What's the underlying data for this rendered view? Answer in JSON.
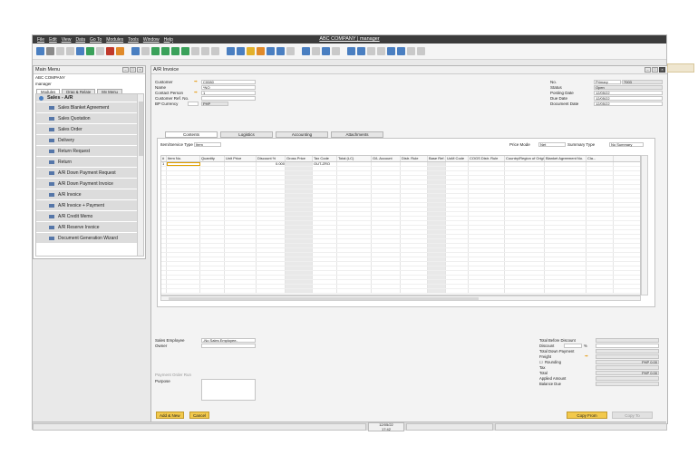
{
  "menu": [
    "File",
    "Edit",
    "View",
    "Data",
    "Go To",
    "Modules",
    "Tools",
    "Window",
    "Help"
  ],
  "app_title": "ABC COMPANY | manager",
  "main_menu": {
    "title": "Main Menu",
    "company": "ABC COMPANY",
    "user": "manager",
    "tabs": [
      "Modules",
      "Drag & Relate",
      "My Menu"
    ],
    "module": "Sales - A/R",
    "items": [
      "Sales Blanket Agreement",
      "Sales Quotation",
      "Sales Order",
      "Delivery",
      "Return Request",
      "Return",
      "A/R Down Payment Request",
      "A/R Down Payment Invoice",
      "A/R Invoice",
      "A/R Invoice + Payment",
      "A/R Credit Memo",
      "A/R Reserve Invoice",
      "Document Generation Wizard"
    ]
  },
  "ar": {
    "title": "A/R Invoice",
    "customer_label": "Customer",
    "customer_value": "C0080",
    "name_label": "Name",
    "name_value": "*NO",
    "contact_label": "Contact Person",
    "contact_value": "1",
    "custref_label": "Customer Ref. No.",
    "bpcur_label": "BP Currency",
    "bpcur_value": "PHP",
    "no_label": "No.",
    "series_value": "Primary",
    "no_value": "7003",
    "status_label": "Status",
    "status_value": "Open",
    "posting_label": "Posting Date",
    "posting_value": "12/05/22",
    "due_label": "Due Date",
    "due_value": "12/05/22",
    "docdate_label": "Document Date",
    "docdate_value": "12/05/22",
    "tabs": [
      "Contents",
      "Logistics",
      "Accounting",
      "Attachments"
    ],
    "item_type_label": "Item/Service Type",
    "item_type_value": "Item",
    "price_mode_label": "Price Mode",
    "price_mode_value": "Net",
    "summary_label": "Summary Type",
    "summary_value": "No Summary",
    "columns": [
      "#",
      "Item No.",
      "Quantity",
      "Unit Price",
      "Discount %",
      "Gross Price",
      "Tax Code",
      "Total (LC)",
      "G/L Account",
      "Distr. Rule",
      "Base Ref.",
      "UoM Code",
      "COGS Distr. Rule",
      "Country/Region of Origin",
      "Blanket Agreement No.",
      "Cla..."
    ],
    "row1": {
      "num": "1",
      "discount": "0.000",
      "tax": "OUT-ZRO"
    },
    "sales_emp_label": "Sales Employee",
    "sales_emp_value": "-No Sales Employee-",
    "owner_label": "Owner",
    "payment_order_label": "Payment Order Run",
    "purpose_label": "Purpose",
    "totals": {
      "before_discount": "Total Before Discount",
      "discount": "Discount",
      "pct": "%",
      "down_payment": "Total Down Payment",
      "freight": "Freight",
      "rounding": "Rounding",
      "rounding_value": "PHP 0.00",
      "tax": "Tax",
      "total": "Total",
      "total_value": "PHP 0.00",
      "applied": "Applied Amount",
      "balance": "Balance Due"
    },
    "buttons": {
      "add_new": "Add & New",
      "cancel": "Cancel",
      "copy_from": "Copy From",
      "copy_to": "Copy To"
    }
  },
  "status": {
    "date": "12/05/22",
    "time": "17:42"
  }
}
